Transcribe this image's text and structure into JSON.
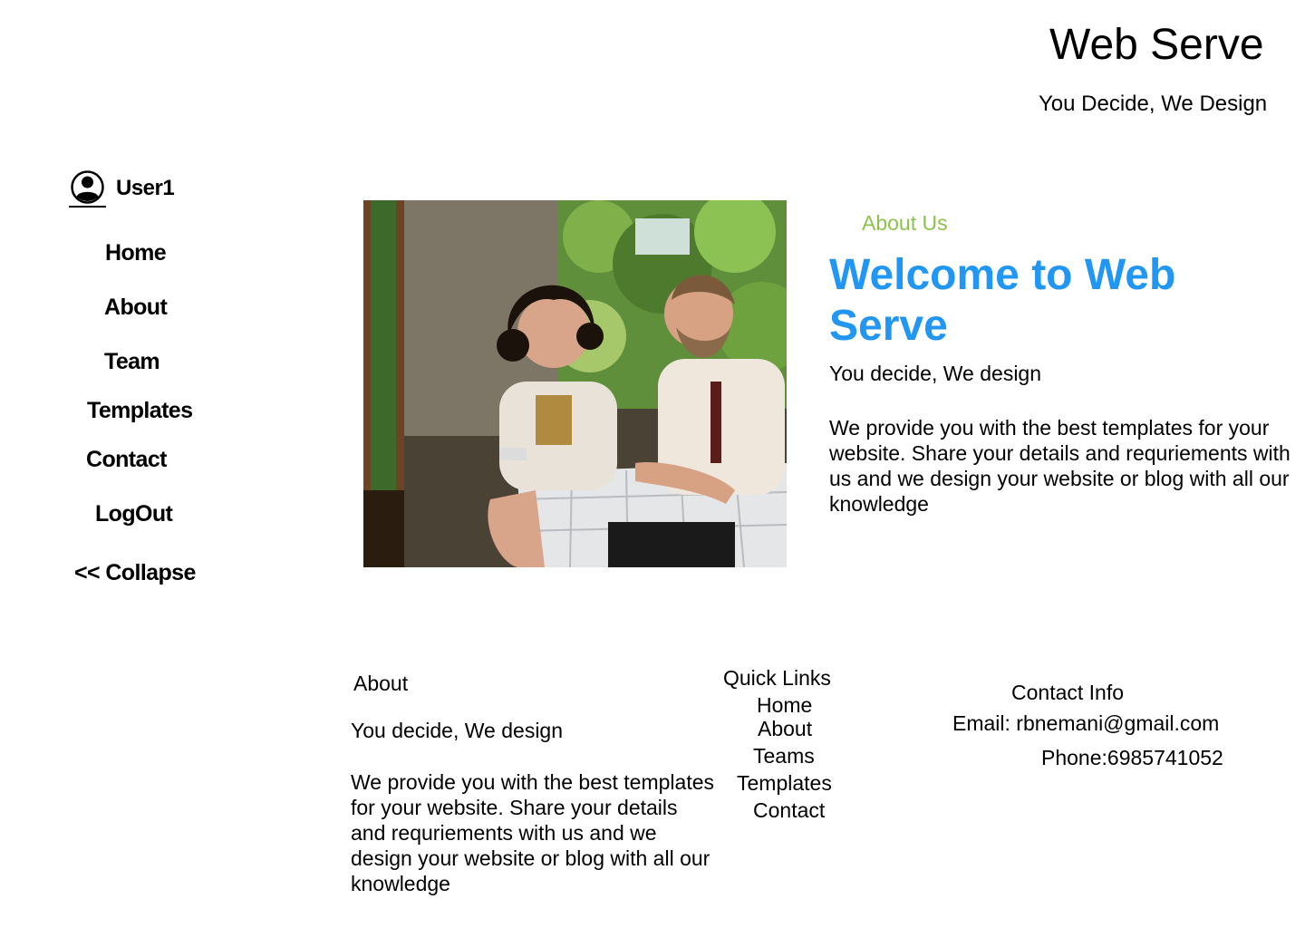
{
  "header": {
    "site_title": "Web Serve",
    "tagline": "You Decide, We Design"
  },
  "sidebar": {
    "user": {
      "name": "User1",
      "icon": "user-circle-icon"
    },
    "items": [
      {
        "label": "Home"
      },
      {
        "label": "About"
      },
      {
        "label": "Team"
      },
      {
        "label": "Templates"
      },
      {
        "label": "Contact"
      },
      {
        "label": "LogOut"
      },
      {
        "label": "<< Collapse"
      }
    ]
  },
  "main": {
    "image": {
      "semantic": "hero-photo-two-people-at-table"
    },
    "eyebrow": "About Us",
    "heading": "Welcome to Web Serve",
    "tagline": "You decide, We design",
    "description": "We provide you with the best templates for your website. Share your details and requriements with us and we design your website or blog with all our knowledge"
  },
  "footer": {
    "about": {
      "title": "About",
      "tagline": "You decide, We design",
      "description": "We provide you with the best templates for your website. Share your details and requriements with us and we design your website or blog with all our knowledge"
    },
    "quick_links": {
      "title": "Quick Links",
      "items": [
        "Home",
        "About",
        "Teams",
        "Templates",
        "Contact"
      ]
    },
    "contact": {
      "title": "Contact Info",
      "email": "Email: rbnemani@gmail.com",
      "phone": "Phone:6985741052"
    }
  },
  "colors": {
    "accent_blue": "#2196f3",
    "accent_green": "#8bc34a",
    "text": "#000000",
    "background": "#ffffff"
  }
}
